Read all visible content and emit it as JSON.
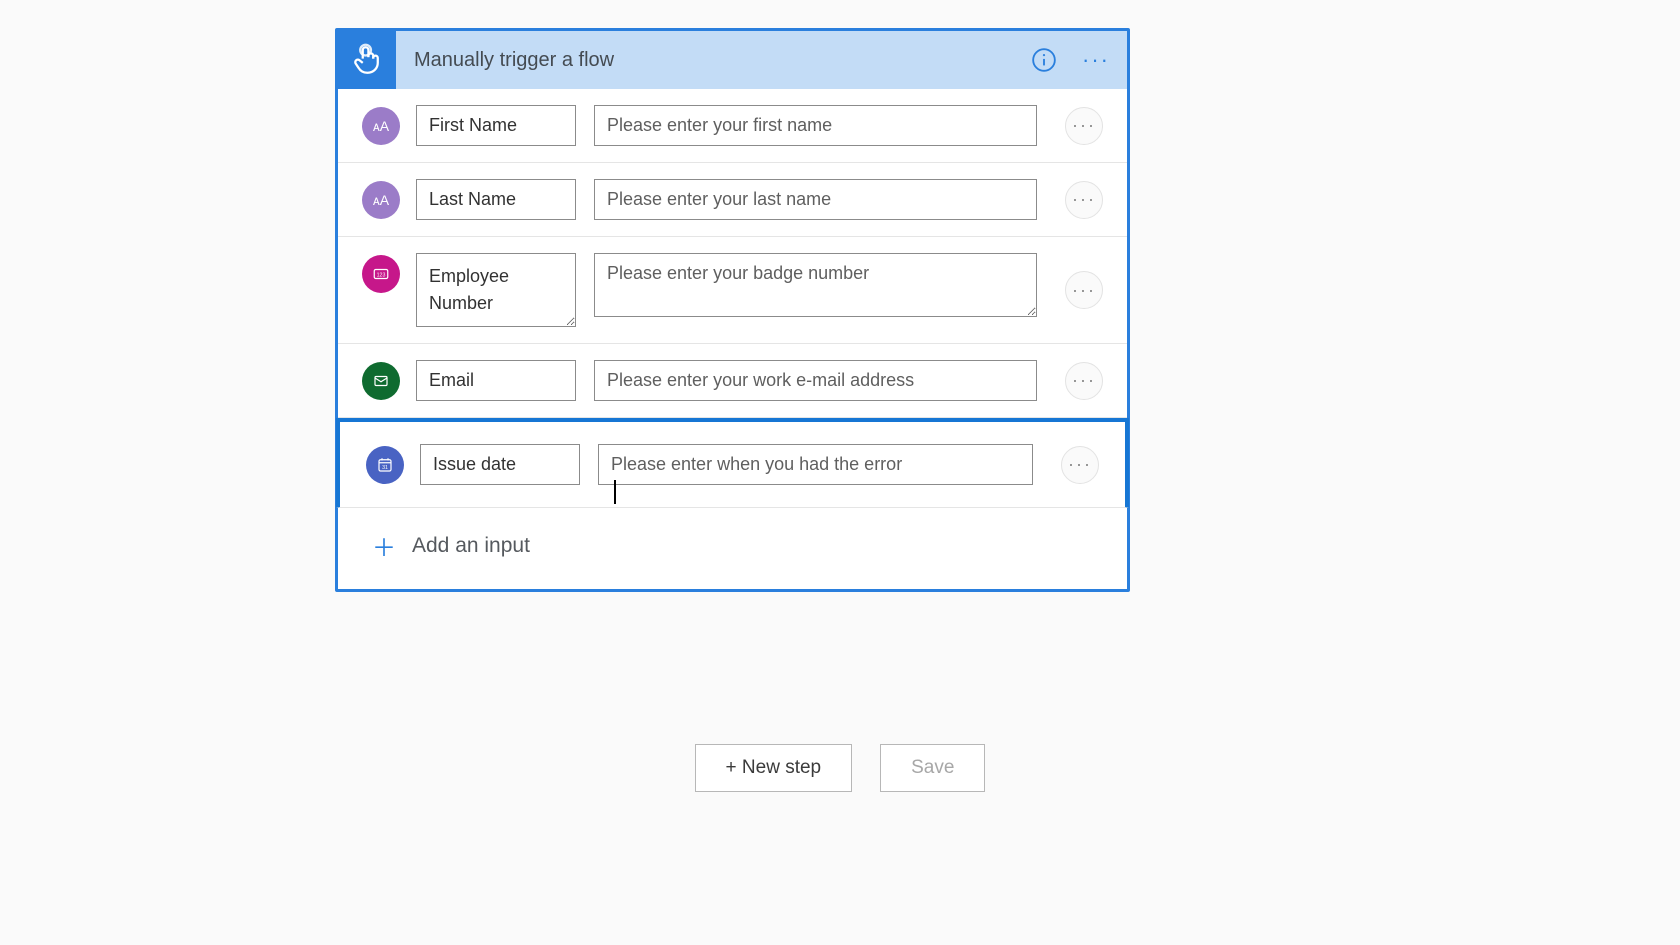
{
  "trigger": {
    "title": "Manually trigger a flow"
  },
  "inputs": [
    {
      "type": "text",
      "name": "First Name",
      "desc": "Please enter your first name"
    },
    {
      "type": "text",
      "name": "Last Name",
      "desc": "Please enter your last name"
    },
    {
      "type": "number",
      "name": "Employee Number",
      "desc": "Please enter your badge number"
    },
    {
      "type": "email",
      "name": "Email",
      "desc": "Please enter your work e-mail address"
    },
    {
      "type": "date",
      "name": "Issue date",
      "desc": "Please enter when you had the error"
    }
  ],
  "labels": {
    "add_input": "Add an input",
    "new_step": "+ New step",
    "save": "Save"
  }
}
